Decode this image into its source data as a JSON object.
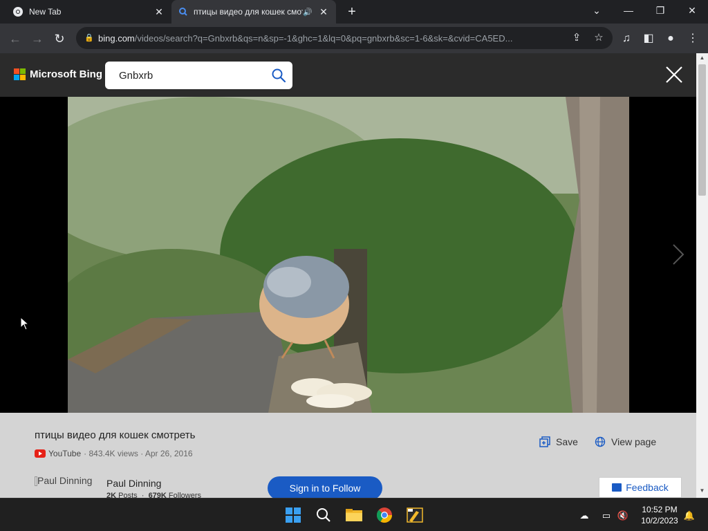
{
  "tabs": [
    {
      "title": "New Tab",
      "icon": "chrome-icon"
    },
    {
      "title": "птицы видео для кошек смотреть",
      "icon": "bing-search-icon",
      "audio": true
    }
  ],
  "address_bar": {
    "host": "bing.com",
    "path": "/videos/search?q=Gnbxrb&qs=n&sp=-1&ghc=1&lq=0&pq=gnbxrb&sc=1-6&sk=&cvid=CA5ED..."
  },
  "bing": {
    "brand": "Microsoft Bing",
    "search_value": "Gnbxrb"
  },
  "video": {
    "title": "птицы видео для кошек смотреть",
    "source": "YouTube",
    "meta": "· 843.4K views · Apr 26, 2016",
    "save_label": "Save",
    "view_page_label": "View page"
  },
  "author": {
    "image_alt": "Paul Dinning",
    "name": "Paul Dinning",
    "posts_count": "2K",
    "posts_label": "Posts",
    "followers_count": "679K",
    "followers_label": "Followers",
    "separator": "·",
    "follow_label": "Sign in to Follow"
  },
  "feedback_label": "Feedback",
  "clock": {
    "time": "10:52 PM",
    "date": "10/2/2023"
  },
  "colors": {
    "accent_blue": "#1a5bc4",
    "ms_red": "#f25022",
    "ms_green": "#7fba00",
    "ms_blue": "#00a4ef",
    "ms_yellow": "#ffb900"
  }
}
